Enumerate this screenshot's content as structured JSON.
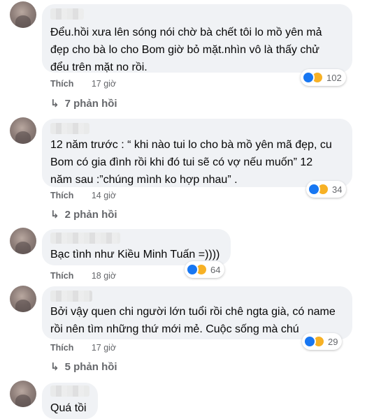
{
  "comments": [
    {
      "text": "Đểu.hồi xưa lên sóng nói chờ bà chết tôi lo mồ yên mả\nđẹp cho bà lo cho Bom giờ bỏ mặt.nhìn vô là thấy chử\nđểu trên mặt no rồi.",
      "like_label": "Thích",
      "time": "17 giờ",
      "reactions": "102",
      "replies": "7 phản hồi"
    },
    {
      "text": "12 năm trước : “ khi nào tui lo cho bà mồ yên mã đẹp, cu\nBom có gia đình rồi khi đó tui sẽ có vợ nếu muốn” 12\nnăm sau :”chúng mình ko hợp nhau” .",
      "like_label": "Thích",
      "time": "14 giờ",
      "reactions": "34",
      "replies": "2 phản hồi"
    },
    {
      "text": "Bạc tình như Kiều Minh Tuấn =))))",
      "like_label": "Thích",
      "time": "18 giờ",
      "reactions": "64"
    },
    {
      "text": "Bởi vậy quen chi người lớn tuổi rồi chê ngta già, có name\nrồi nên tìm những thứ mới mẻ. Cuộc sống mà chú",
      "like_label": "Thích",
      "time": "17 giờ",
      "reactions": "29",
      "replies": "5 phản hồi"
    },
    {
      "text": "Quá tồi"
    }
  ],
  "reaction_icons": [
    "like-icon",
    "haha-icon"
  ],
  "colors": {
    "bubble": "#f0f2f5",
    "like_blue": "#1877f2",
    "haha_yellow": "#f7b125",
    "meta_gray": "#65676b"
  }
}
